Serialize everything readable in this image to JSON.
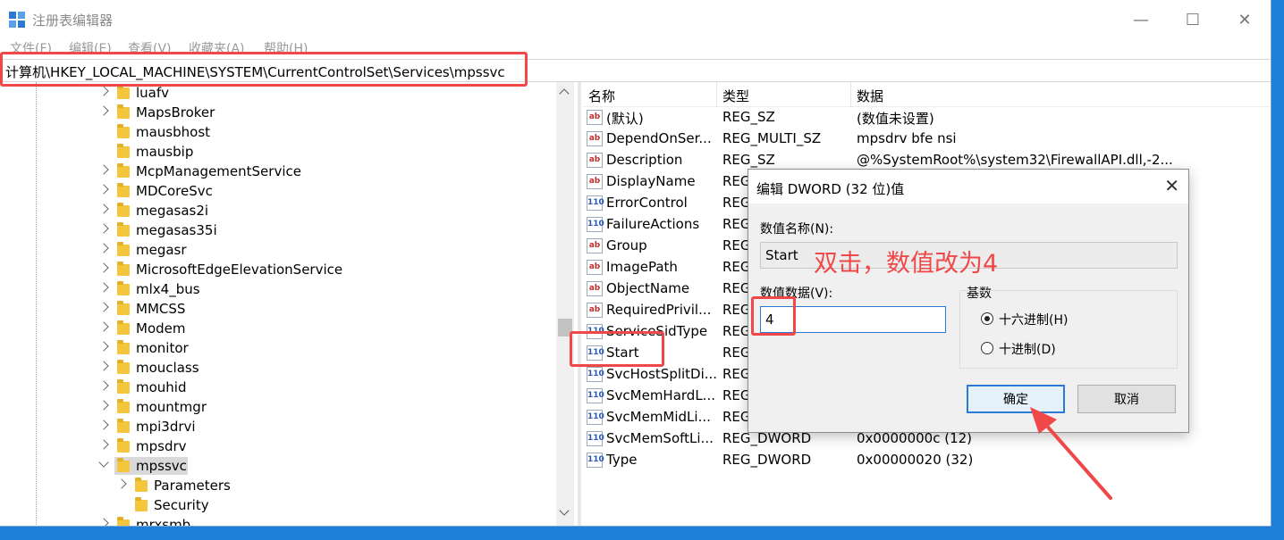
{
  "window": {
    "title": "注册表编辑器",
    "minimize": "—",
    "maximize": "☐",
    "close": "✕"
  },
  "menu": [
    "文件(F)",
    "编辑(E)",
    "查看(V)",
    "收藏夹(A)",
    "帮助(H)"
  ],
  "address": "计算机\\HKEY_LOCAL_MACHINE\\SYSTEM\\CurrentControlSet\\Services\\mpssvc",
  "tree": [
    {
      "label": "luafv",
      "expander": "collapsed"
    },
    {
      "label": "MapsBroker",
      "expander": "collapsed"
    },
    {
      "label": "mausbhost",
      "expander": "none"
    },
    {
      "label": "mausbip",
      "expander": "none"
    },
    {
      "label": "McpManagementService",
      "expander": "collapsed"
    },
    {
      "label": "MDCoreSvc",
      "expander": "collapsed"
    },
    {
      "label": "megasas2i",
      "expander": "collapsed"
    },
    {
      "label": "megasas35i",
      "expander": "collapsed"
    },
    {
      "label": "megasr",
      "expander": "collapsed"
    },
    {
      "label": "MicrosoftEdgeElevationService",
      "expander": "collapsed"
    },
    {
      "label": "mlx4_bus",
      "expander": "collapsed"
    },
    {
      "label": "MMCSS",
      "expander": "collapsed"
    },
    {
      "label": "Modem",
      "expander": "collapsed"
    },
    {
      "label": "monitor",
      "expander": "collapsed"
    },
    {
      "label": "mouclass",
      "expander": "collapsed"
    },
    {
      "label": "mouhid",
      "expander": "collapsed"
    },
    {
      "label": "mountmgr",
      "expander": "collapsed"
    },
    {
      "label": "mpi3drvi",
      "expander": "collapsed"
    },
    {
      "label": "mpsdrv",
      "expander": "collapsed"
    },
    {
      "label": "mpssvc",
      "expander": "expanded",
      "selected": true
    },
    {
      "label": "Parameters",
      "expander": "collapsed",
      "child": true
    },
    {
      "label": "Security",
      "expander": "none",
      "child": true
    },
    {
      "label": "mrxsmb",
      "expander": "collapsed"
    }
  ],
  "list": {
    "headers": {
      "name": "名称",
      "type": "类型",
      "data": "数据"
    },
    "rows": [
      {
        "icon": "string-value-icon",
        "icon_text": "ab",
        "name": "(默认)",
        "type": "REG_SZ",
        "data": "(数值未设置)"
      },
      {
        "icon": "string-value-icon",
        "icon_text": "ab",
        "name": "DependOnSer...",
        "type": "REG_MULTI_SZ",
        "data": "mpsdrv bfe nsi"
      },
      {
        "icon": "string-value-icon",
        "icon_text": "ab",
        "name": "Description",
        "type": "REG_SZ",
        "data": "@%SystemRoot%\\system32\\FirewallAPI.dll,-2..."
      },
      {
        "icon": "string-value-icon",
        "icon_text": "ab",
        "name": "DisplayName",
        "type": "REG",
        "data": ""
      },
      {
        "icon": "binary-value-icon",
        "icon_text": "110",
        "name": "ErrorControl",
        "type": "REG",
        "data": ""
      },
      {
        "icon": "binary-value-icon",
        "icon_text": "110",
        "name": "FailureActions",
        "type": "REG",
        "data": ""
      },
      {
        "icon": "string-value-icon",
        "icon_text": "ab",
        "name": "Group",
        "type": "REG",
        "data": ""
      },
      {
        "icon": "string-value-icon",
        "icon_text": "ab",
        "name": "ImagePath",
        "type": "REG",
        "data": ""
      },
      {
        "icon": "string-value-icon",
        "icon_text": "ab",
        "name": "ObjectName",
        "type": "REG",
        "data": ""
      },
      {
        "icon": "string-value-icon",
        "icon_text": "ab",
        "name": "RequiredPrivil...",
        "type": "REG",
        "data": ""
      },
      {
        "icon": "binary-value-icon",
        "icon_text": "110",
        "name": "ServiceSidType",
        "type": "REG",
        "data": ""
      },
      {
        "icon": "binary-value-icon",
        "icon_text": "110",
        "name": "Start",
        "type": "REG",
        "data": ""
      },
      {
        "icon": "binary-value-icon",
        "icon_text": "110",
        "name": "SvcHostSplitDi...",
        "type": "REG",
        "data": ""
      },
      {
        "icon": "binary-value-icon",
        "icon_text": "110",
        "name": "SvcMemHardL...",
        "type": "REG",
        "data": ""
      },
      {
        "icon": "binary-value-icon",
        "icon_text": "110",
        "name": "SvcMemMidLi...",
        "type": "REG",
        "data": ""
      },
      {
        "icon": "binary-value-icon",
        "icon_text": "110",
        "name": "SvcMemSoftLi...",
        "type": "REG_DWORD",
        "data": "0x0000000c (12)"
      },
      {
        "icon": "binary-value-icon",
        "icon_text": "110",
        "name": "Type",
        "type": "REG_DWORD",
        "data": "0x00000020 (32)"
      }
    ]
  },
  "dialog": {
    "title": "编辑 DWORD (32 位)值",
    "close": "✕",
    "name_label": "数值名称(N):",
    "name_value": "Start",
    "data_label": "数值数据(V):",
    "data_value": "4",
    "base_label": "基数",
    "hex_label": "十六进制(H)",
    "dec_label": "十进制(D)",
    "hex_selected": true,
    "ok": "确定",
    "cancel": "取消"
  },
  "annotation": "双击，数值改为4",
  "colors": {
    "highlight": "#f04848",
    "accent": "#2a7ad6",
    "desktop": "#1e7fd8"
  }
}
